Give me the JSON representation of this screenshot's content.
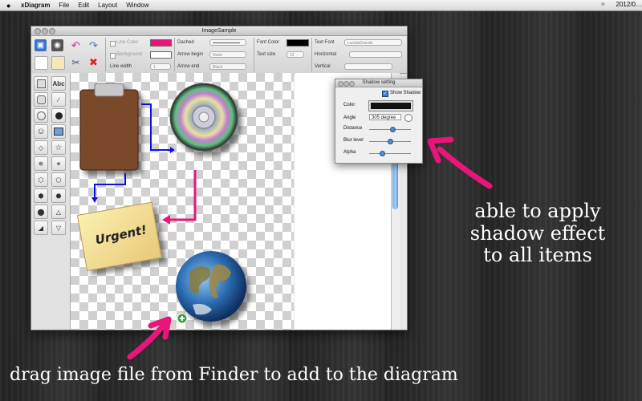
{
  "menubar": {
    "apple": "",
    "app_name": "xDiagram",
    "items": [
      "File",
      "Edit",
      "Layout",
      "Window"
    ],
    "clock": "2012/0…"
  },
  "window": {
    "title": "ImageSample",
    "toolbar": {
      "line_color_label": "Line Color",
      "line_color": "#e8167a",
      "background_label": "Background",
      "line_width_label": "Line width",
      "line_width_value": "1",
      "dashed_label": "Dashed",
      "arrow_begin_label": "Arrow begin",
      "arrow_begin_value": "None",
      "arrow_end_label": "Arrow end",
      "arrow_end_value": "Black",
      "font_color_label": "Font Color",
      "font_color": "#000000",
      "text_size_label": "Text size",
      "text_size_value": "12",
      "text_font_label": "Text Font",
      "text_font_value": "LucidaGrande",
      "horizontal_label": "Horizontal",
      "vertical_label": "Vertical"
    },
    "palette": {
      "text_tool": "Abc"
    },
    "canvas": {
      "note_text": "Urgent!"
    }
  },
  "shadow_panel": {
    "title": "Shadow setting",
    "show_shadow_label": "Show Shadow",
    "show_shadow_checked": true,
    "color_label": "Color",
    "color": "#111111",
    "angle_label": "Angle",
    "angle_value": "305 degree",
    "distance_label": "Distance",
    "distance_level": 0.55,
    "blur_label": "Blur level",
    "blur_level": 0.5,
    "alpha_label": "Alpha",
    "alpha_level": 0.3
  },
  "captions": {
    "shadow": "able to apply shadow effect to all items",
    "shadow_lines": [
      "able to apply",
      "shadow effect",
      "to all items"
    ],
    "drag": "drag image file from Finder to add to the diagram"
  },
  "colors": {
    "accent_arrow": "#e8167a",
    "connector_blue": "#1010e0"
  }
}
